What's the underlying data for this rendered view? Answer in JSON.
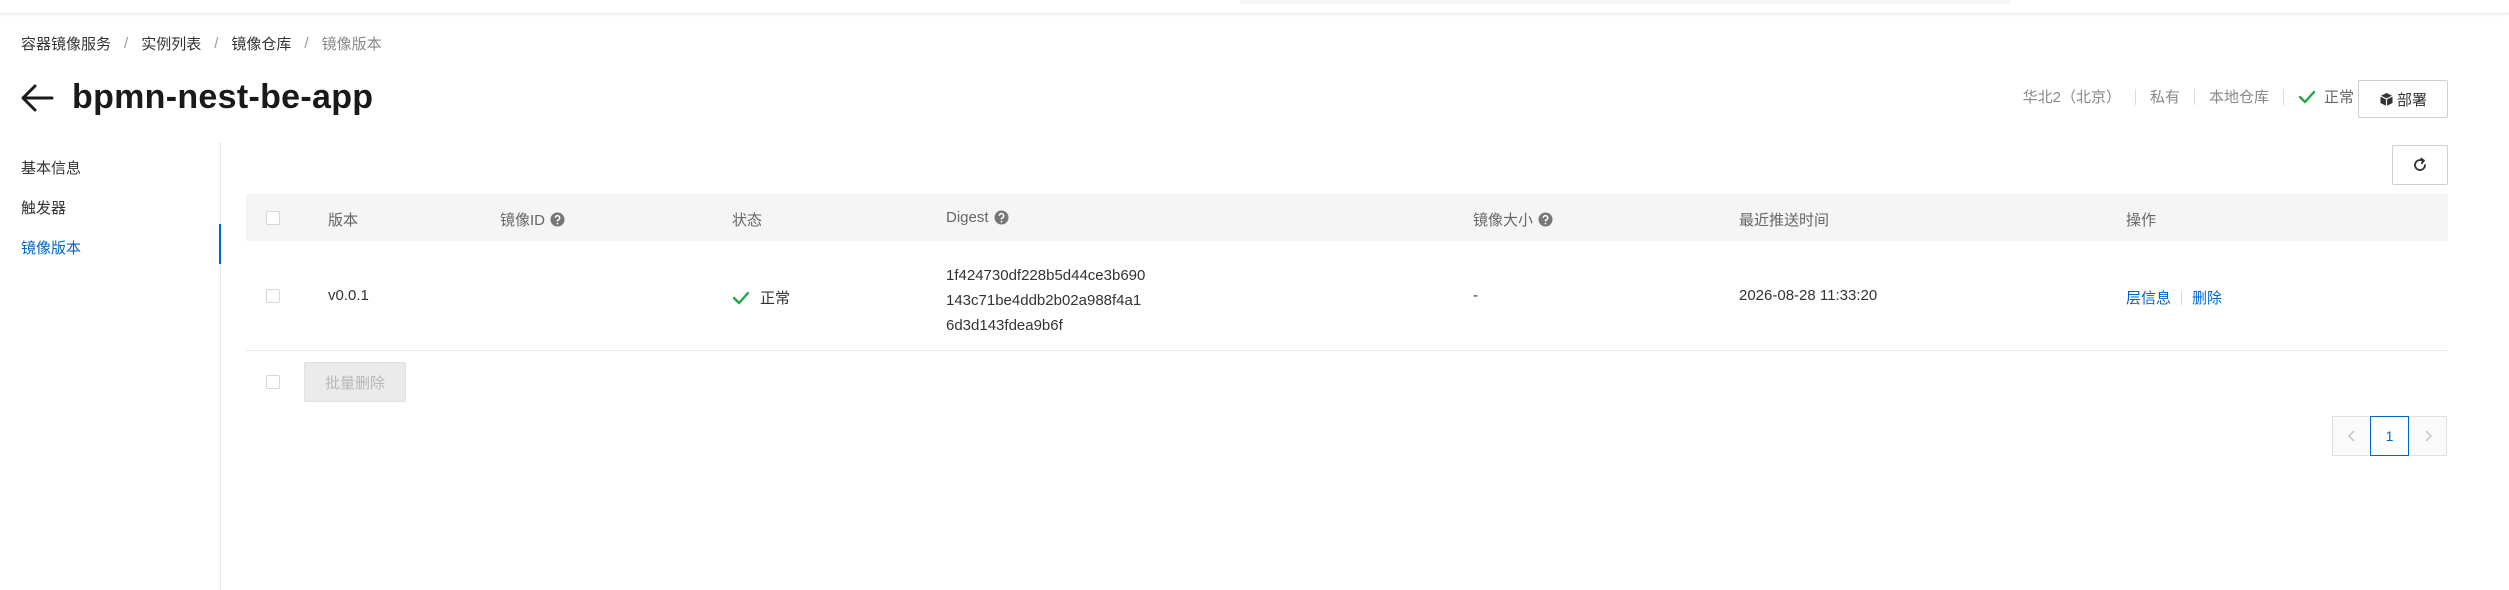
{
  "breadcrumb": {
    "items": [
      "容器镜像服务",
      "实例列表",
      "镜像仓库"
    ],
    "current": "镜像版本",
    "separator": "/"
  },
  "header": {
    "title": "bpmn-nest-be-app",
    "region": "华北2（北京）",
    "visibility": "私有",
    "source": "本地仓库",
    "status": "正常",
    "deploy_label": "部署"
  },
  "sidebar": {
    "items": [
      {
        "label": "基本信息",
        "active": false
      },
      {
        "label": "触发器",
        "active": false
      },
      {
        "label": "镜像版本",
        "active": true
      }
    ]
  },
  "table": {
    "columns": {
      "version": "版本",
      "image_id": "镜像ID",
      "status": "状态",
      "digest": "Digest",
      "size": "镜像大小",
      "pushed_at": "最近推送时间",
      "actions": "操作"
    },
    "rows": [
      {
        "version": "v0.0.1",
        "image_id": "",
        "status": "正常",
        "digest_lines": [
          "1f424730df228b5d44ce3b690",
          "143c71be4ddb2b02a988f4a1",
          "6d3d143fdea9b6f"
        ],
        "size": "-",
        "pushed_at": "2026-08-28 11:33:20",
        "action_layer": "层信息",
        "action_delete": "删除"
      }
    ],
    "batch_delete_label": "批量删除"
  },
  "pagination": {
    "current_page": "1"
  },
  "colors": {
    "accent": "#0066cc",
    "success": "#23a745",
    "muted": "#888888"
  }
}
